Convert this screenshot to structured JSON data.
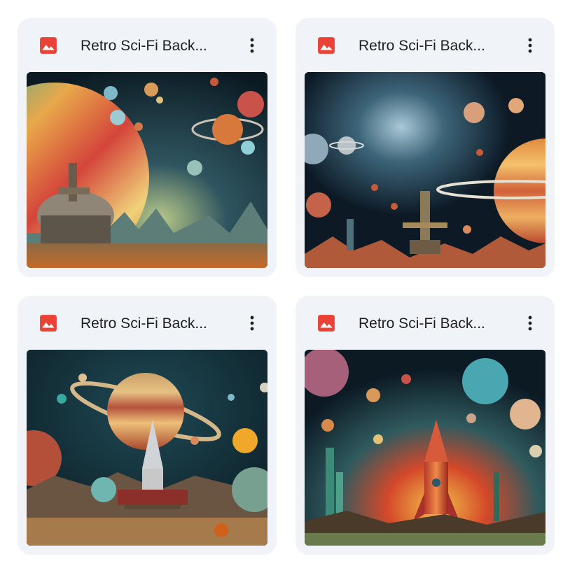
{
  "files": [
    {
      "title": "Retro Sci-Fi Back...",
      "type_icon": "image-file-icon",
      "menu_icon": "more-vert-icon"
    },
    {
      "title": "Retro Sci-Fi Back...",
      "type_icon": "image-file-icon",
      "menu_icon": "more-vert-icon"
    },
    {
      "title": "Retro Sci-Fi Back...",
      "type_icon": "image-file-icon",
      "menu_icon": "more-vert-icon"
    },
    {
      "title": "Retro Sci-Fi Back...",
      "type_icon": "image-file-icon",
      "menu_icon": "more-vert-icon"
    }
  ],
  "colors": {
    "card_bg": "#f0f4f9",
    "icon_red": "#ea4335",
    "text": "#1f1f1f"
  }
}
